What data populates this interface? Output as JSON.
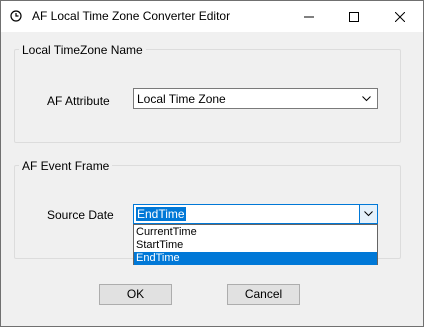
{
  "window": {
    "title": "AF Local Time Zone Converter Editor",
    "icon": "clock-icon",
    "controls": [
      "minimize-icon",
      "maximize-icon",
      "close-icon"
    ]
  },
  "group_timezone": {
    "label": "Local TimeZone Name",
    "attribute_label": "AF Attribute",
    "attribute_value": "Local Time Zone"
  },
  "group_eventframe": {
    "label": "AF Event Frame",
    "source_label": "Source Date",
    "source_value": "EndTime",
    "options": [
      "CurrentTime",
      "StartTime",
      "EndTime"
    ],
    "selected_index": 2
  },
  "buttons": {
    "ok": "OK",
    "cancel": "Cancel"
  },
  "colors": {
    "accent": "#0078d7",
    "dialog_bg": "#f0f0f0"
  }
}
